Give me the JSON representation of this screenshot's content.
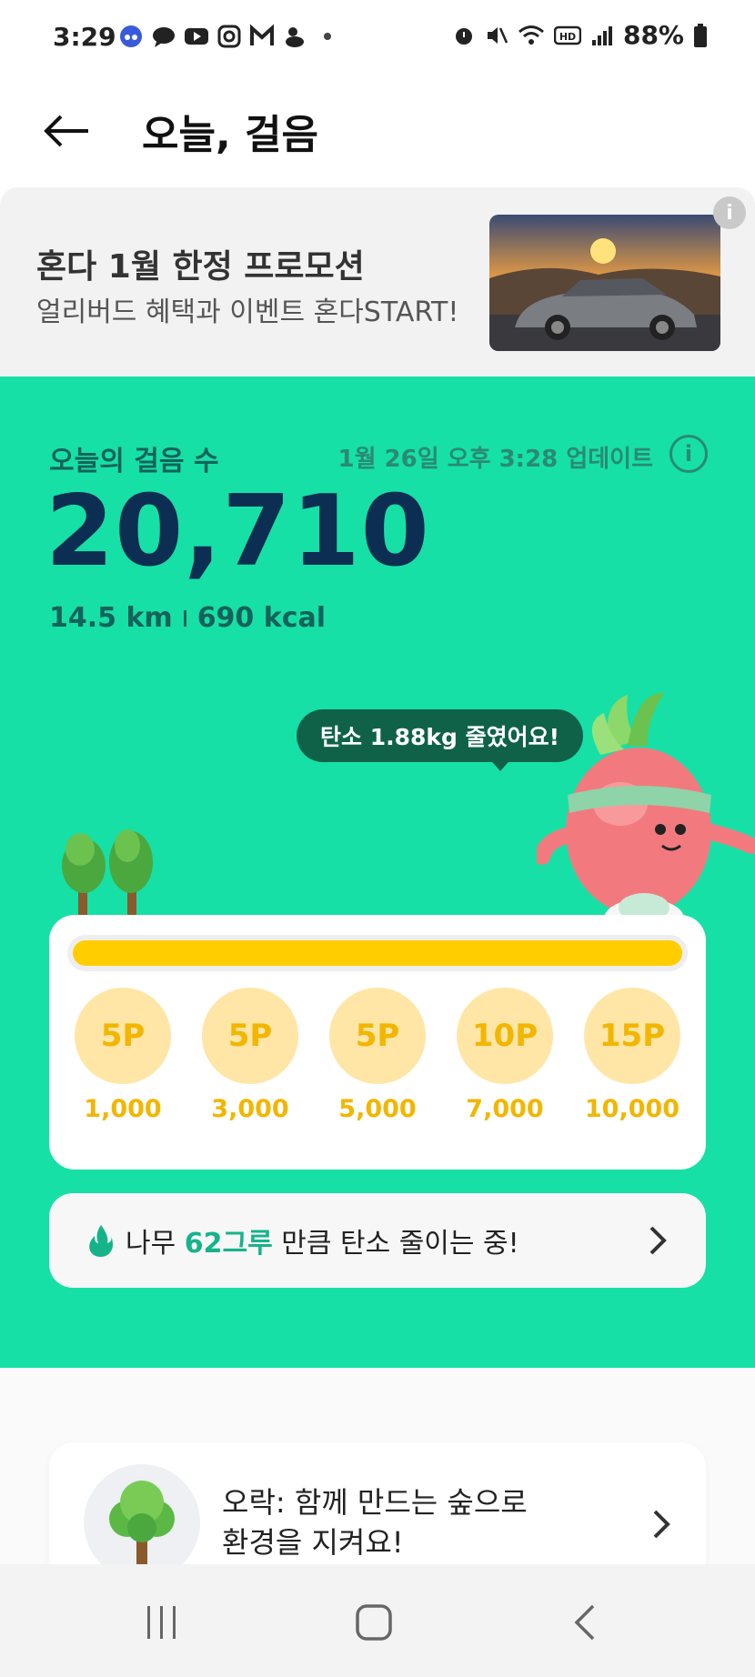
{
  "status_bar": {
    "time": "3:29",
    "battery": "88%"
  },
  "header": {
    "title": "오늘, 걸음"
  },
  "ad": {
    "title": "혼다 1월 한정 프로모션",
    "subtitle": "얼리버드 혜택과 이벤트 혼다START!",
    "info_label": "i"
  },
  "steps": {
    "label": "오늘의 걸음 수",
    "updated": "1월 26일 오후 3:28 업데이트",
    "count": "20,710",
    "distance": "14.5 km",
    "calories": "690 kcal",
    "info_label": "i"
  },
  "carbon_bubble": "탄소 1.88kg 줄였어요!",
  "progress": {
    "fraction": 1.0,
    "milestones": [
      {
        "points": "5P",
        "steps": "1,000"
      },
      {
        "points": "5P",
        "steps": "3,000"
      },
      {
        "points": "5P",
        "steps": "5,000"
      },
      {
        "points": "10P",
        "steps": "7,000"
      },
      {
        "points": "15P",
        "steps": "10,000"
      }
    ]
  },
  "tree_banner": {
    "prefix": "나무 ",
    "highlight": "62그루",
    "suffix": " 만큼 탄소 줄이는 중!"
  },
  "forest_card": {
    "line1": "오락: 함께 만드는 숲으로",
    "line2": "환경을 지켜요!"
  },
  "colors": {
    "green_bg": "#16e0a6",
    "dark_navy": "#0c2e52",
    "yellow": "#ffcd00",
    "coin_bg": "#ffe6a6"
  }
}
